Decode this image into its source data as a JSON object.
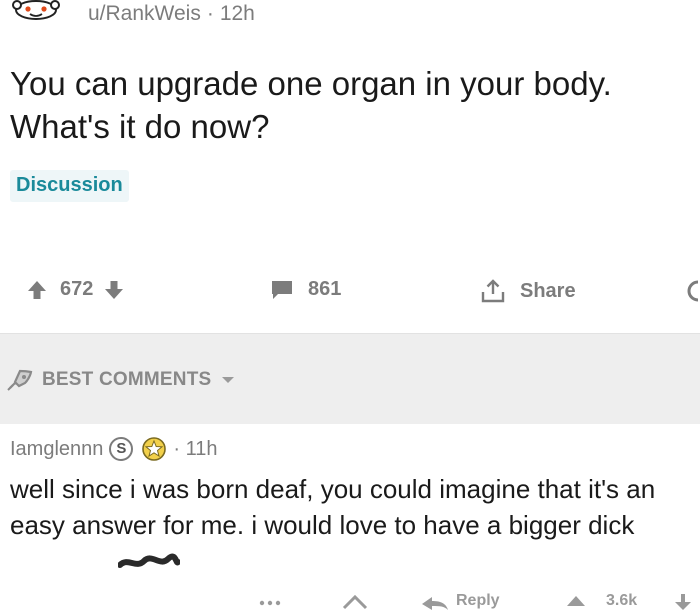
{
  "post": {
    "author": "u/RankWeis",
    "separator": "·",
    "age": "12h",
    "title": "You can upgrade one organ in your body. What's it do now?",
    "flair": "Discussion"
  },
  "actions": {
    "score": "672",
    "comment_count": "861",
    "share_label": "Share"
  },
  "best_comments": {
    "label": "BEST COMMENTS"
  },
  "comment": {
    "username": "Iamglennn",
    "badge_letter": "S",
    "separator": "·",
    "age": "11h",
    "body": "well since i was born deaf, you could imagine that it's an easy answer for me. i would love to have a bigger dick"
  },
  "bottom_actions": {
    "reply_label": "Reply",
    "score_partial": "3.6k"
  },
  "colors": {
    "meta_gray": "#7c7c7c",
    "flair_text": "#1a8a9a",
    "flair_bg": "#eef6f8",
    "bar_bg": "#eeeeee"
  }
}
